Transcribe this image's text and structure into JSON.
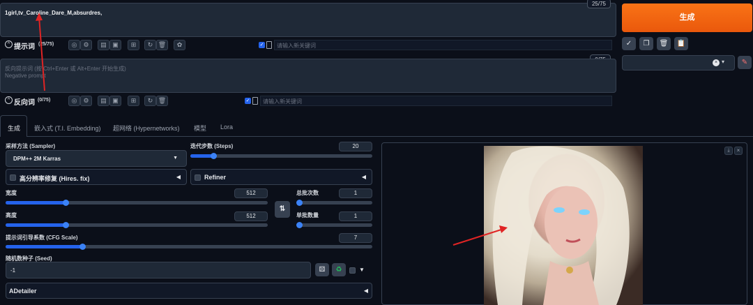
{
  "prompt": {
    "text": "1girl,tv_Caroline_Dare_M,absurdres,",
    "counter": "25/75",
    "label": "提示词",
    "label_counter": "(25/75)",
    "keyword_placeholder": "请输入新关键词"
  },
  "negative": {
    "placeholder_line1": "反向提示词 (按 Ctrl+Enter 或 Alt+Enter 开始生成)",
    "placeholder_line2": "Negative prompt",
    "counter": "0/75",
    "label": "反向词",
    "label_counter": "(0/75)",
    "keyword_placeholder": "请输入新关键词"
  },
  "generate_button": "生成",
  "tabs": [
    "生成",
    "嵌入式 (T.I. Embedding)",
    "超网络 (Hypernetworks)",
    "模型",
    "Lora"
  ],
  "sampler": {
    "label": "采样方法 (Sampler)",
    "value": "DPM++ 2M Karras"
  },
  "steps": {
    "label": "迭代步数 (Steps)",
    "value": "20",
    "fraction": 0.13
  },
  "hires": {
    "label": "高分辨率修复 (Hires. fix)"
  },
  "refiner": {
    "label": "Refiner"
  },
  "width": {
    "label": "宽度",
    "value": "512",
    "fraction": 0.23
  },
  "height": {
    "label": "高度",
    "value": "512",
    "fraction": 0.23
  },
  "batch_count": {
    "label": "总批次数",
    "value": "1",
    "fraction": 0.0
  },
  "batch_size": {
    "label": "单批数量",
    "value": "1",
    "fraction": 0.0
  },
  "cfg": {
    "label": "提示词引导系数 (CFG Scale)",
    "value": "7",
    "fraction": 0.21
  },
  "seed": {
    "label": "随机数种子 (Seed)",
    "value": "-1"
  },
  "adetailer": {
    "label": "ADetailer"
  },
  "colors": {
    "accent": "#ea580c",
    "blue": "#2563eb",
    "annotation": "#e02424"
  }
}
